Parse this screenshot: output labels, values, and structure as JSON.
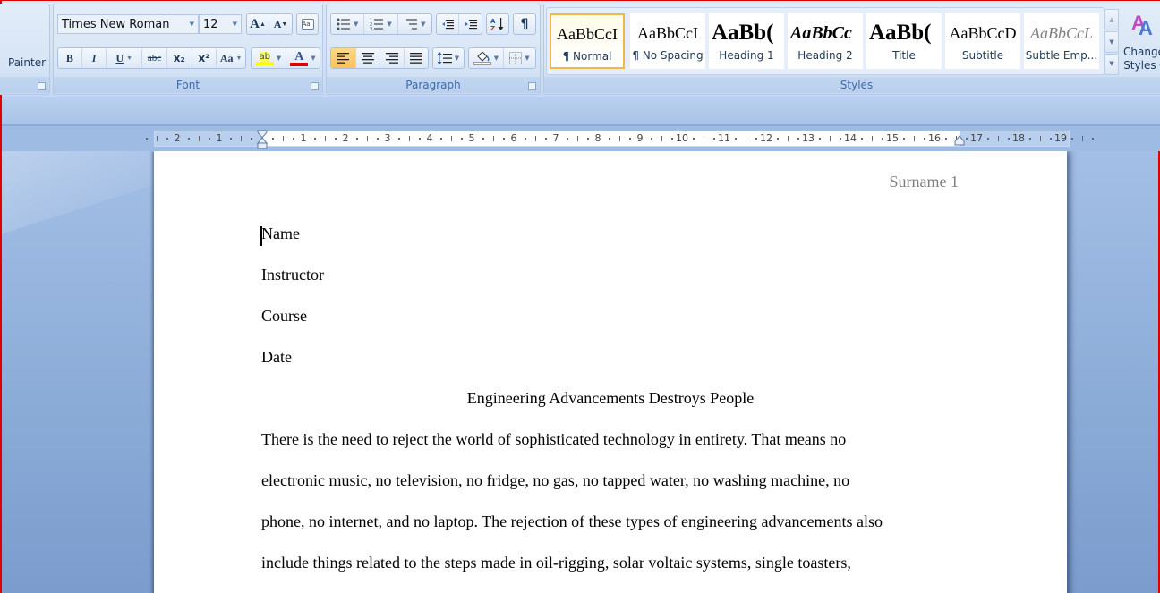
{
  "ribbon": {
    "clipboard": {
      "format_painter_label": "Painter"
    },
    "font": {
      "group_label": "Font",
      "font_name": "Times New Roman",
      "font_size": "12",
      "grow_font": "A",
      "shrink_font": "A",
      "clear_formatting": "A̶",
      "bold": "B",
      "italic": "I",
      "underline": "U",
      "strikethrough": "abc",
      "subscript": "x₂",
      "superscript": "x²",
      "change_case": "Aa",
      "highlight": "ab",
      "font_color": "A",
      "highlight_color": "#ffff00",
      "font_color_value": "#e00000"
    },
    "paragraph": {
      "group_label": "Paragraph",
      "active_alignment": "left"
    },
    "styles": {
      "group_label": "Styles",
      "items": [
        {
          "preview": "AaBbCcI",
          "name": "¶ Normal",
          "selected": true
        },
        {
          "preview": "AaBbCcI",
          "name": "¶ No Spacing",
          "selected": false
        },
        {
          "preview": "AaBb(",
          "name": "Heading 1",
          "selected": false
        },
        {
          "preview": "AaBbCc",
          "name": "Heading 2",
          "selected": false
        },
        {
          "preview": "AaBb(",
          "name": "Title",
          "selected": false
        },
        {
          "preview": "AaBbCcD",
          "name": "Subtitle",
          "selected": false
        },
        {
          "preview": "AaBbCcL",
          "name": "Subtle Emp...",
          "selected": false
        }
      ],
      "change_styles_line1": "Change",
      "change_styles_line2": "Styles"
    }
  },
  "ruler": {
    "left_labels": [
      "2",
      "1"
    ],
    "right_labels": [
      "1",
      "2",
      "3",
      "4",
      "5",
      "6",
      "7",
      "8",
      "9",
      "10",
      "11",
      "12",
      "13",
      "14",
      "15",
      "16",
      "17",
      "18",
      "19"
    ]
  },
  "document": {
    "header": "Surname 1",
    "lines": [
      "Name",
      "Instructor",
      "Course",
      "Date"
    ],
    "title": "Engineering Advancements Destroys People",
    "body_lines": [
      "There is the need to reject the world of sophisticated technology in entirety. That means no",
      "electronic music, no television, no fridge, no gas, no tapped water, no washing machine, no",
      "phone, no internet, and no laptop. The rejection of these types of engineering advancements also",
      "include things related to the steps made in oil-rigging, solar voltaic systems, single toasters,"
    ]
  }
}
